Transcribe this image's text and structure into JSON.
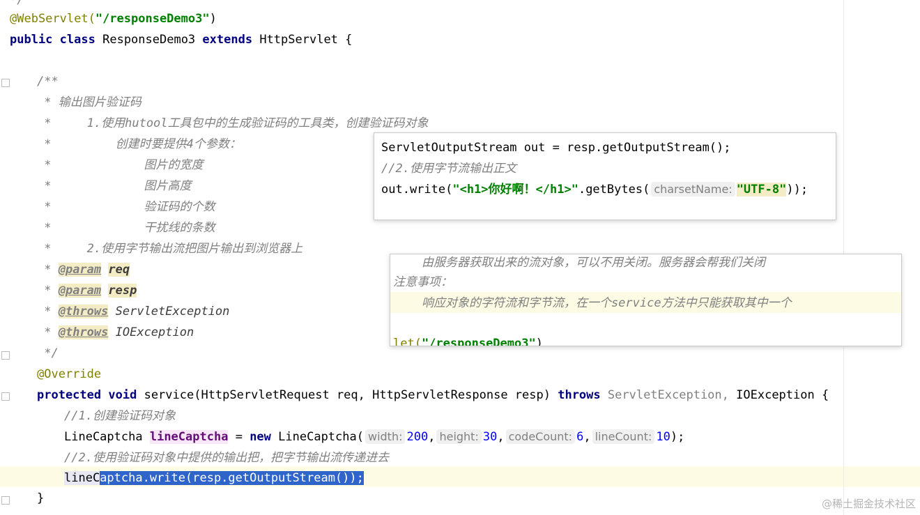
{
  "code": {
    "top_fragment": "*/",
    "annotation_webservlet": "@WebServlet(",
    "servlet_path": "\"/responseDemo3\"",
    "annotation_close": ")",
    "kw_public": "public",
    "kw_class": "class",
    "class_name": "ResponseDemo3",
    "kw_extends": "extends",
    "super_class": "HttpServlet {",
    "doc_open": "/**",
    "doc_line1": " * 输出图片验证码",
    "doc_line2": " *     1.使用hutool工具包中的生成验证码的工具类，创建验证码对象",
    "doc_line3": " *         创建时要提供4个参数：",
    "doc_line4": " *             图片的宽度",
    "doc_line5": " *             图片高度",
    "doc_line6": " *             验证码的个数",
    "doc_line7": " *             干扰线的条数",
    "doc_line8": " *     2.使用字节输出流把图片输出到浏览器上",
    "doc_star": " * ",
    "tag_param": "@param",
    "param_req": "req",
    "param_resp": "resp",
    "tag_throws": "@throws",
    "exc_servlet": "ServletException",
    "exc_io": "IOException",
    "doc_close": " */",
    "annotation_override": "@Override",
    "kw_protected": "protected",
    "kw_void": "void",
    "method_sig": "service(HttpServletRequest req, HttpServletResponse resp)",
    "kw_throws": "throws",
    "throws_servlet": "ServletException,",
    "throws_io": "IOException {",
    "comment1": "//1.创建验证码对象",
    "type_linecaptcha": "LineCaptcha",
    "var_linecaptcha": "lineCaptcha",
    "assign": "=",
    "kw_new": "new",
    "ctor": "LineCaptcha(",
    "hint_width": "width:",
    "val_width": "200",
    "hint_height": "height:",
    "val_height": "30",
    "hint_codecount": "codeCount:",
    "val_codecount": "6",
    "hint_linecount": "lineCount:",
    "val_linecount": "10",
    "ctor_close": ");",
    "comment2": "//2.使用验证码对象中提供的输出把，把字节输出流传递进去",
    "write_pre": "lineC",
    "write_selected": "aptcha.write(resp.getOutputStream());",
    "close_brace": "}"
  },
  "popup1": {
    "line1": "ServletOutputStream out = resp.getOutputStream();",
    "line2": "//2.使用字节流输出正文",
    "line3_pre": "out.write(",
    "line3_str": "\"<h1>你好啊！</h1>\"",
    "line3_mid": ".getBytes(",
    "line3_hint": "charsetName:",
    "line3_arg": "\"UTF-8\"",
    "line3_end": "));"
  },
  "popup2": {
    "line1": "    由服务器获取出来的流对象，可以不用关闭。服务器会帮我们关闭",
    "line2": "注意事项：",
    "line3": "    响应对象的字符流和字节流，在一个service方法中只能获取其中一个",
    "line4_pre": "let(",
    "line4_str": "\"/responseDemo3\"",
    "line4_end": ")"
  },
  "watermark": "@稀土掘金技术社区",
  "colors": {
    "keyword": "#000080",
    "annotation": "#808000",
    "string": "#008000",
    "comment": "#808080",
    "number": "#0000ff",
    "selection": "#2f65ca",
    "current_line": "#fdfbe4"
  }
}
